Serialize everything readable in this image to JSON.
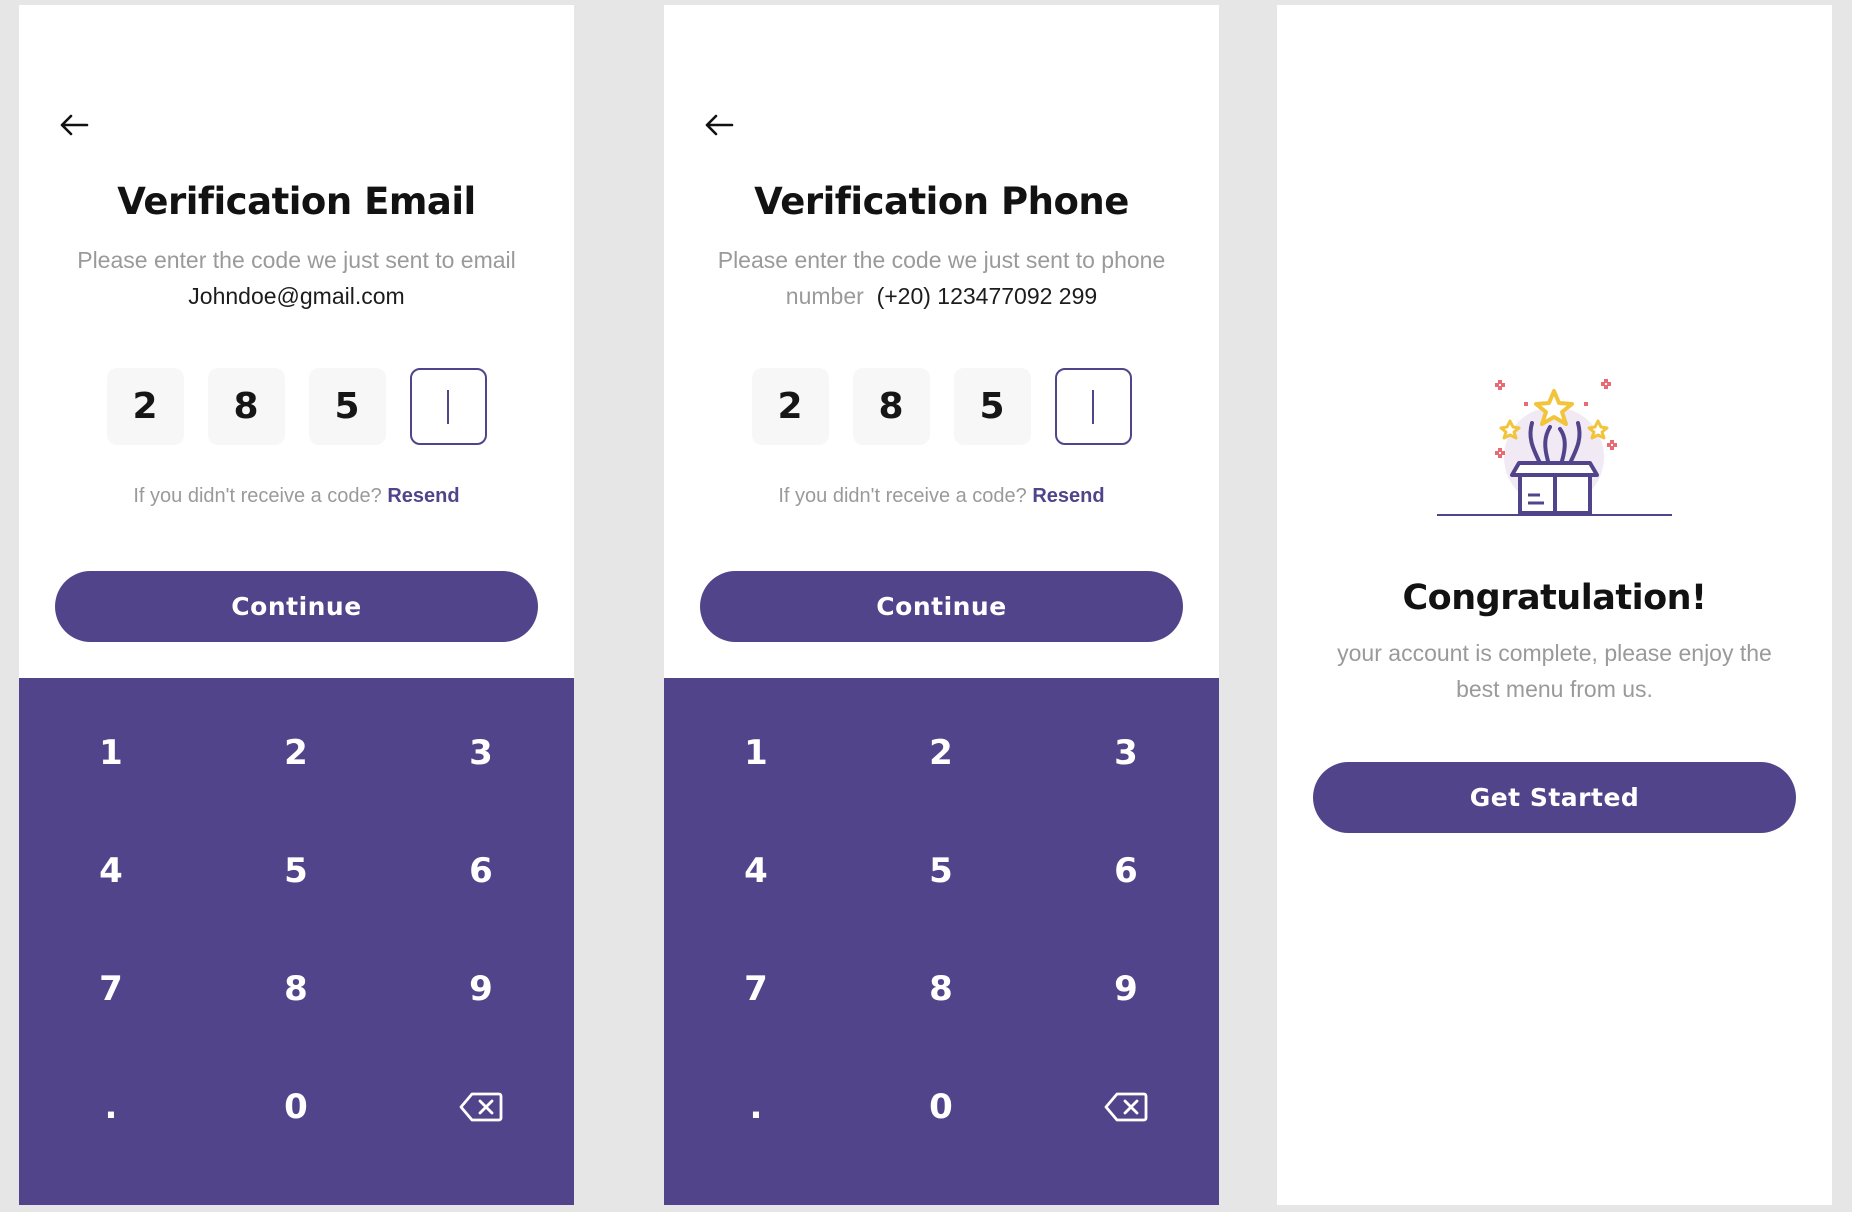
{
  "colors": {
    "primary": "#52448a",
    "background": "#e6e6e6",
    "muted": "#9a9a9a"
  },
  "email_screen": {
    "back_icon": "arrow-left-icon",
    "title": "Verification Email",
    "subtitle": "Please enter the code we just sent to email",
    "contact": "Johndoe@gmail.com",
    "digits": [
      "2",
      "8",
      "5"
    ],
    "resend_prompt": "If you didn't receive a code?",
    "resend_link": "Resend",
    "continue_label": "Continue"
  },
  "phone_screen": {
    "back_icon": "arrow-left-icon",
    "title": "Verification Phone",
    "subtitle_line1": "Please enter the code we just sent to phone",
    "subtitle_line2": "number",
    "contact": "(+20) 123477092 299",
    "digits": [
      "2",
      "8",
      "5"
    ],
    "resend_prompt": "If you didn't receive a code?",
    "resend_link": "Resend",
    "continue_label": "Continue"
  },
  "keypad": {
    "keys": [
      "1",
      "2",
      "3",
      "4",
      "5",
      "6",
      "7",
      "8",
      "9",
      ".",
      "0"
    ],
    "delete_icon": "backspace-icon"
  },
  "done_screen": {
    "illustration": "gift-box-celebration-icon",
    "title": "Congratulation!",
    "message": "your account is complete, please enjoy the best menu from us.",
    "button_label": "Get Started"
  }
}
